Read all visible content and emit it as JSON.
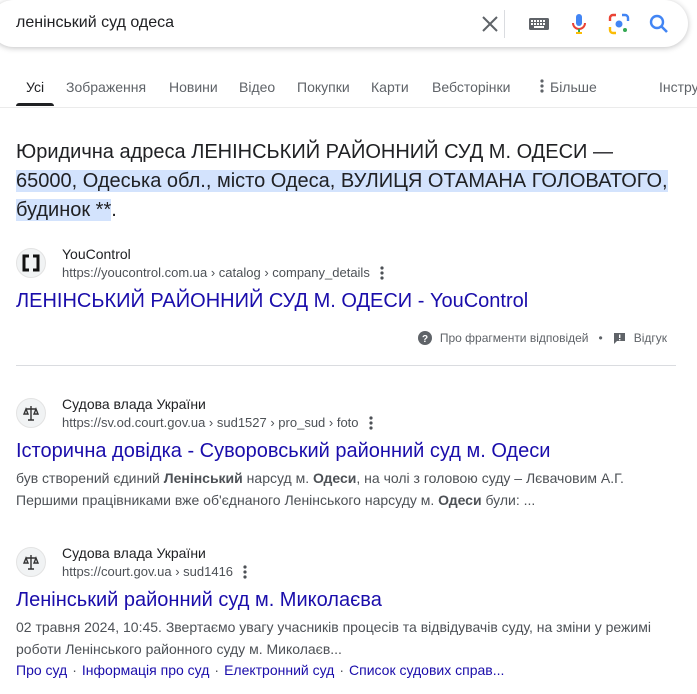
{
  "search": {
    "query": "ленінський суд одеса"
  },
  "tabs": [
    {
      "label": "Усі",
      "active": true
    },
    {
      "label": "Зображення"
    },
    {
      "label": "Новини"
    },
    {
      "label": "Відео"
    },
    {
      "label": "Покупки"
    },
    {
      "label": "Карти"
    },
    {
      "label": "Вебсторінки"
    },
    {
      "label": "Більше"
    },
    {
      "label": "Інстру"
    }
  ],
  "featured": {
    "text_before": "Юридична адреса ЛЕНІНСЬКИЙ РАЙОННИЙ СУД М. ОДЕСИ — ",
    "text_highlight": "65000, Одеська обл., місто Одеса, ВУЛИЦЯ ОТАМАНА ГОЛОВАТОГО, будинок **",
    "text_after": "."
  },
  "results": [
    {
      "site_name": "YouControl",
      "url": "https://youcontrol.com.ua › catalog › company_details",
      "title": "ЛЕНІНСЬКИЙ РАЙОННИЙ СУД М. ОДЕСИ - YouControl"
    },
    {
      "site_name": "Судова влада України",
      "url": "https://sv.od.court.gov.ua › sud1527 › pro_sud › foto",
      "title": "Історична довідка - Суворовський районний суд м. Одеси",
      "snippet_parts": [
        "був створений єдиний ",
        "Ленінський",
        " нарсуд м. ",
        "Одеси",
        ", на чолі з головою суду – Лєвачовим А.Г. Першими працівниками вже об'єднаного Ленінського нарсуду м. ",
        "Одеси",
        " були: ..."
      ]
    },
    {
      "site_name": "Судова влада України",
      "url": "https://court.gov.ua › sud1416",
      "title": "Ленінський районний суд м. Миколаєва",
      "snippet": "02 травня 2024, 10:45. Звертаємо увагу учасників процесів та відвідувачів суду, на зміни у режимі роботи Ленінського районного суду м. Миколаєв...",
      "sitelinks": [
        "Про суд",
        "Інформація про суд",
        "Електронний суд",
        "Список судових справ..."
      ]
    }
  ],
  "feedback": {
    "about_label": "Про фрагменти відповідей",
    "feedback_label": "Відгук"
  },
  "icons": {
    "clear": "close-icon",
    "keyboard": "keyboard-icon",
    "voice": "microphone-icon",
    "lens": "lens-icon",
    "search": "search-icon"
  },
  "colors": {
    "link": "#1a0dab",
    "highlight": "#d3e3fd",
    "google_blue": "#4285f4"
  }
}
